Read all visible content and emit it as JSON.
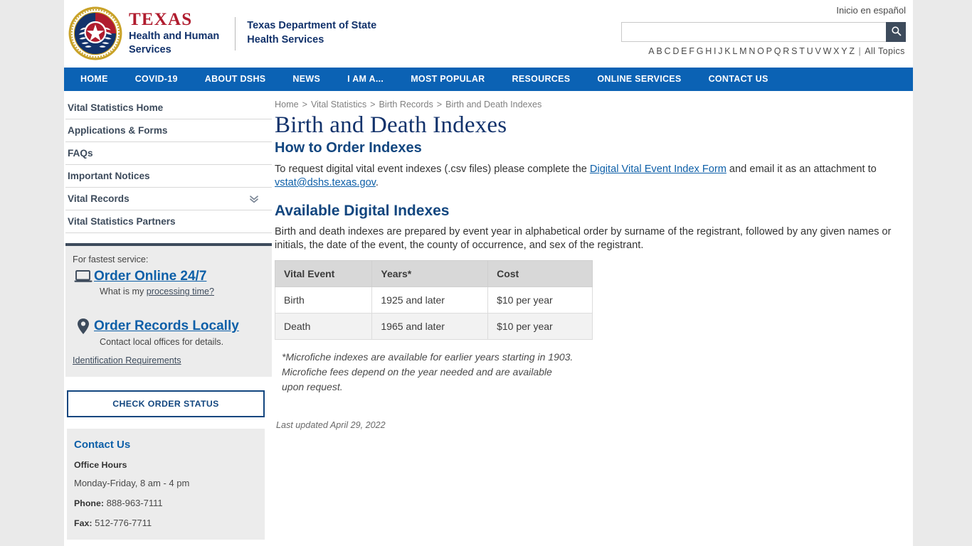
{
  "brand": {
    "texas": "TEXAS",
    "hhs_line1": "Health and Human",
    "hhs_line2": "Services",
    "dshs_line1": "Texas Department of State",
    "dshs_line2": "Health Services",
    "seal_icon": "texas-state-seal"
  },
  "utility": {
    "espanol_label": "Inicio en español",
    "search_value": "",
    "search_placeholder": "",
    "search_icon": "search-icon",
    "alphabet": [
      "A",
      "B",
      "C",
      "D",
      "E",
      "F",
      "G",
      "H",
      "I",
      "J",
      "K",
      "L",
      "M",
      "N",
      "O",
      "P",
      "Q",
      "R",
      "S",
      "T",
      "U",
      "V",
      "W",
      "X",
      "Y",
      "Z"
    ],
    "alpha_separator": "|",
    "all_topics_label": "All Topics"
  },
  "mainnav": {
    "items": [
      {
        "label": "HOME"
      },
      {
        "label": "COVID-19"
      },
      {
        "label": "ABOUT DSHS"
      },
      {
        "label": "NEWS"
      },
      {
        "label": "I AM A..."
      },
      {
        "label": "MOST POPULAR"
      },
      {
        "label": "RESOURCES"
      },
      {
        "label": "ONLINE SERVICES"
      },
      {
        "label": "CONTACT US"
      }
    ]
  },
  "sidebar": {
    "nav_items": [
      {
        "label": "Vital Statistics Home",
        "expandable": false
      },
      {
        "label": "Applications & Forms",
        "expandable": false
      },
      {
        "label": "FAQs",
        "expandable": false
      },
      {
        "label": "Important Notices",
        "expandable": false
      },
      {
        "label": "Vital Records",
        "expandable": true
      },
      {
        "label": "Vital Statistics Partners",
        "expandable": false
      }
    ],
    "service_box": {
      "lead": "For fastest service:",
      "online_icon": "laptop-icon",
      "online_link": "Order Online 24/7",
      "online_sub_prefix": "What is my ",
      "online_sub_link": "processing time?",
      "local_icon": "map-pin-icon",
      "local_link": "Order Records Locally",
      "local_sub": "Contact local offices for details.",
      "id_requirements_link": "Identification Requirements"
    },
    "status_button": "CHECK ORDER STATUS",
    "contact": {
      "title": "Contact Us",
      "hours_label": "Office Hours",
      "hours_value": "Monday-Friday, 8 am - 4 pm",
      "phone_label": "Phone:",
      "phone_value": "888-963-7111",
      "fax_label": "Fax:",
      "fax_value": "512-776-7711"
    }
  },
  "content": {
    "breadcrumb": [
      {
        "label": "Home"
      },
      {
        "label": "Vital Statistics"
      },
      {
        "label": "Birth Records"
      },
      {
        "label": "Birth and Death Indexes"
      }
    ],
    "breadcrumb_arrow": ">",
    "title": "Birth and Death Indexes",
    "subheading": "How to Order Indexes",
    "intro_part1": "To request digital vital event indexes (.csv files) please complete the ",
    "intro_link1": "Digital Vital Event Index Form",
    "intro_part2": " and email it as an attachment to ",
    "intro_link2": "vstat@dshs.texas.gov",
    "intro_part3": ".",
    "section_heading": "Available Digital Indexes",
    "section_para": "Birth and death indexes are prepared by event year in alphabetical order by surname of the registrant, followed by any given names or initials, the date of the event, the county of occurrence, and sex of the registrant.",
    "table": {
      "headers": [
        "Vital Event",
        "Years*",
        "Cost"
      ],
      "rows": [
        [
          "Birth",
          "1925 and later",
          "$10 per year"
        ],
        [
          "Death",
          "1965 and later",
          "$10 per year"
        ]
      ]
    },
    "note_line1": "*Microfiche indexes are available for earlier years starting in 1903.",
    "note_line2": "Microfiche fees depend on the year needed and are available",
    "note_line3": "upon request.",
    "last_updated_label": "Last updated",
    "last_updated_date": "April 29, 2022"
  },
  "colors": {
    "nav_blue": "#0b62b4",
    "title_navy": "#12326b",
    "link_blue": "#0d5fa8",
    "slate": "#3d4b5c",
    "texas_red": "#b01c2e",
    "page_bg": "#eaeaea",
    "box_gray": "#ececec"
  }
}
